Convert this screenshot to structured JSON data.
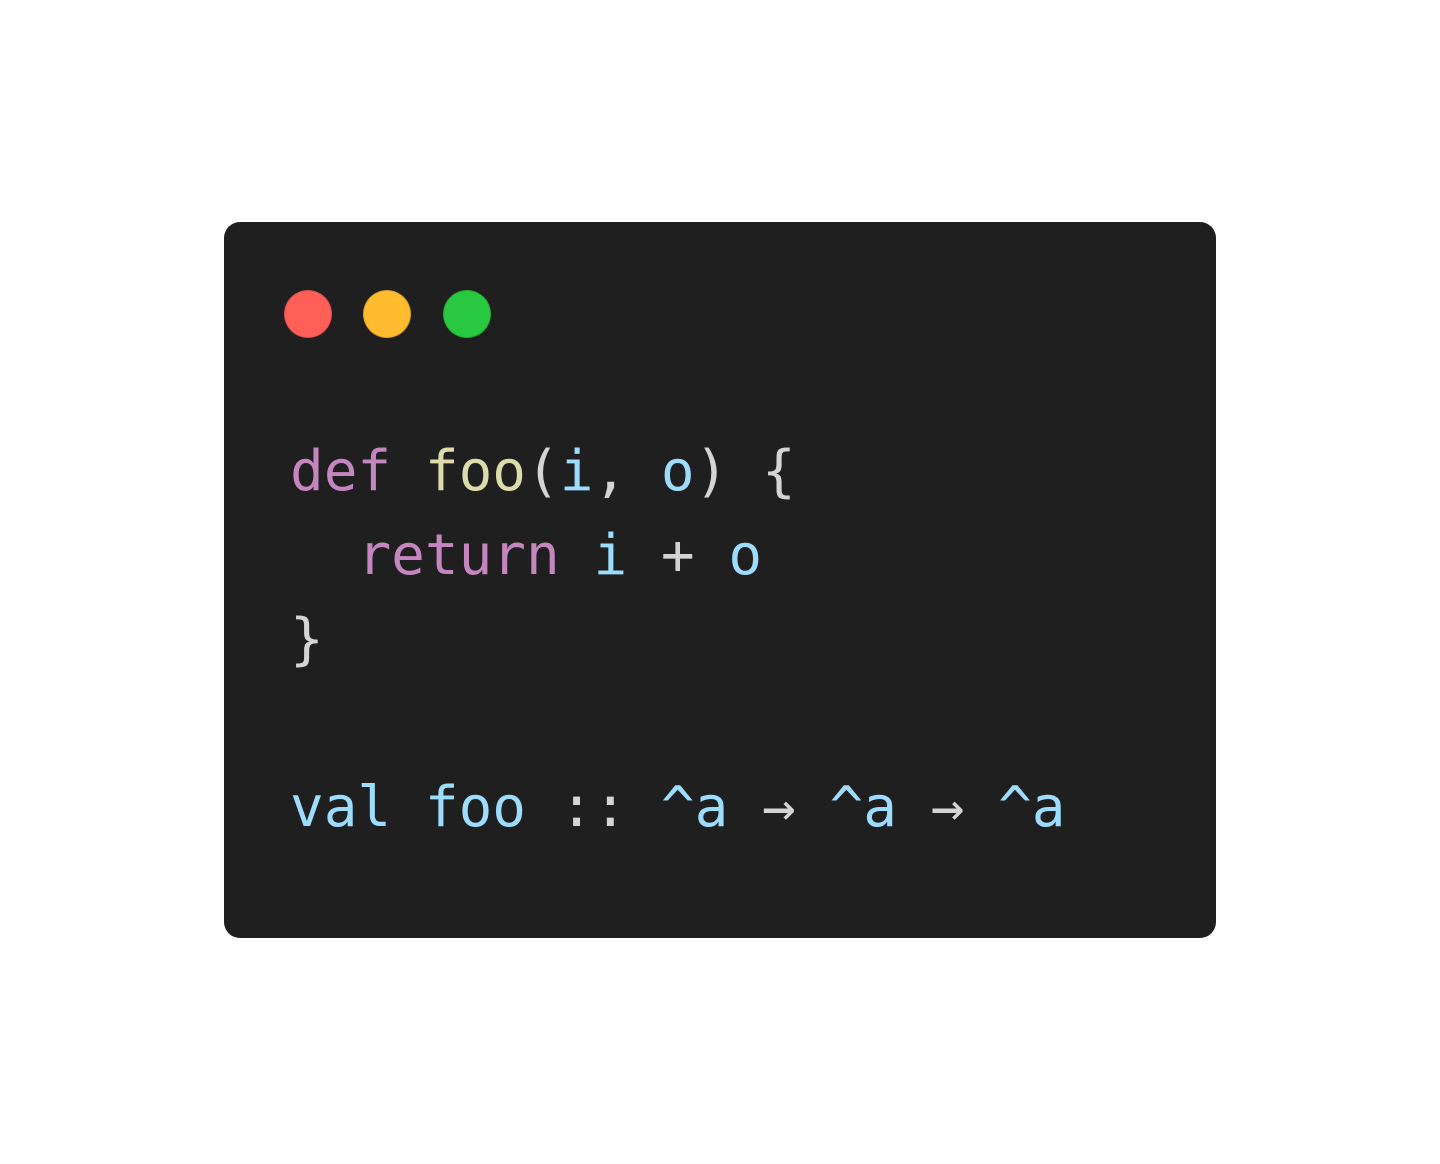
{
  "colors": {
    "page_background": "#ffffff",
    "window_background": "#1f1f1f",
    "traffic_red": "#ff5f57",
    "traffic_yellow": "#febc2e",
    "traffic_green": "#28c840",
    "keyword": "#c586c0",
    "function_name": "#dcdcaa",
    "identifier": "#9cdcfe",
    "punctuation": "#d4d4d4"
  },
  "window": {
    "controls": [
      {
        "name": "close",
        "color": "#ff5f57"
      },
      {
        "name": "minimize",
        "color": "#febc2e"
      },
      {
        "name": "maximize",
        "color": "#28c840"
      }
    ]
  },
  "code": {
    "line1": {
      "kw_def": "def",
      "sp1": " ",
      "fn_name": "foo",
      "paren_open": "(",
      "param_i": "i",
      "comma": ", ",
      "param_o": "o",
      "paren_close": ")",
      "brace_open": " {"
    },
    "line2": {
      "indent": "  ",
      "kw_return": "return",
      "sp1": " ",
      "var_i": "i",
      "op_plus": " + ",
      "var_o": "o"
    },
    "line3": {
      "brace_close": "}"
    },
    "line5": {
      "kw_val": "val",
      "sp1": " ",
      "name_foo": "foo",
      "colons": " :: ",
      "type_a1": "^a",
      "arrow1": " → ",
      "type_a2": "^a",
      "arrow2": " → ",
      "type_a3": "^a"
    }
  }
}
